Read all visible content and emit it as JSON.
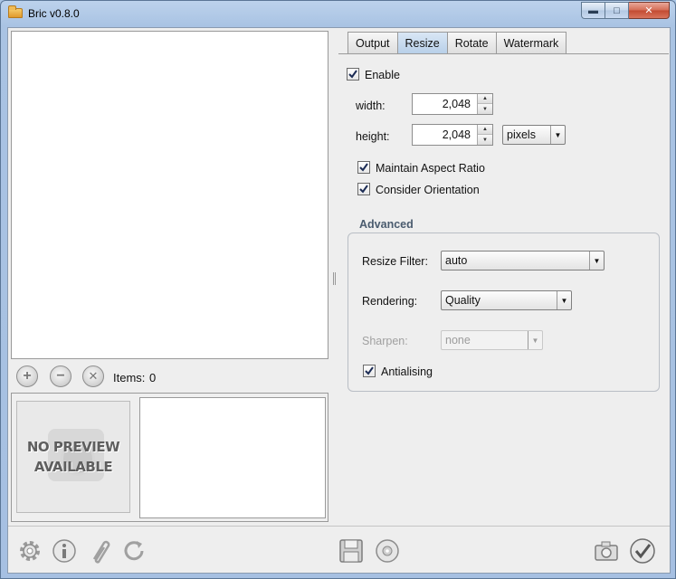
{
  "window": {
    "title": "Bric v0.8.0",
    "controls": {
      "minimize": "▬",
      "maximize": "□",
      "close": "✕"
    }
  },
  "left": {
    "toolbar": {
      "add_icon": "plus-circle-icon",
      "remove_icon": "minus-circle-icon",
      "clear_icon": "x-circle-icon",
      "items_label": "Items:",
      "items_count": "0"
    },
    "preview": {
      "placeholder_text": "NO PREVIEW\nAVAILABLE"
    }
  },
  "tabs": [
    {
      "label": "Output",
      "active": false
    },
    {
      "label": "Resize",
      "active": true
    },
    {
      "label": "Rotate",
      "active": false
    },
    {
      "label": "Watermark",
      "active": false
    }
  ],
  "resize": {
    "enable": {
      "label": "Enable",
      "checked": true
    },
    "width": {
      "label": "width:",
      "value": "2,048"
    },
    "height": {
      "label": "height:",
      "value": "2,048"
    },
    "unit": {
      "value": "pixels"
    },
    "maintain_aspect": {
      "label": "Maintain Aspect Ratio",
      "checked": true
    },
    "consider_orientation": {
      "label": "Consider Orientation",
      "checked": true
    },
    "advanced": {
      "title": "Advanced",
      "resize_filter": {
        "label": "Resize Filter:",
        "value": "auto"
      },
      "rendering": {
        "label": "Rendering:",
        "value": "Quality"
      },
      "sharpen": {
        "label": "Sharpen:",
        "value": "none",
        "enabled": false
      },
      "antialiasing": {
        "label": "Antialising",
        "checked": true
      }
    }
  },
  "bottom_toolbar": {
    "left_icons": [
      "gear-icon",
      "info-icon",
      "paperclip-icon",
      "refresh-icon"
    ],
    "middle_icons": [
      "save-disk-icon",
      "cd-icon"
    ],
    "right_icons": [
      "camera-icon",
      "check-icon"
    ]
  },
  "colors": {
    "accent": "#b7cfe8",
    "frame": "#a9c4e4",
    "panel": "#eeeeee"
  }
}
